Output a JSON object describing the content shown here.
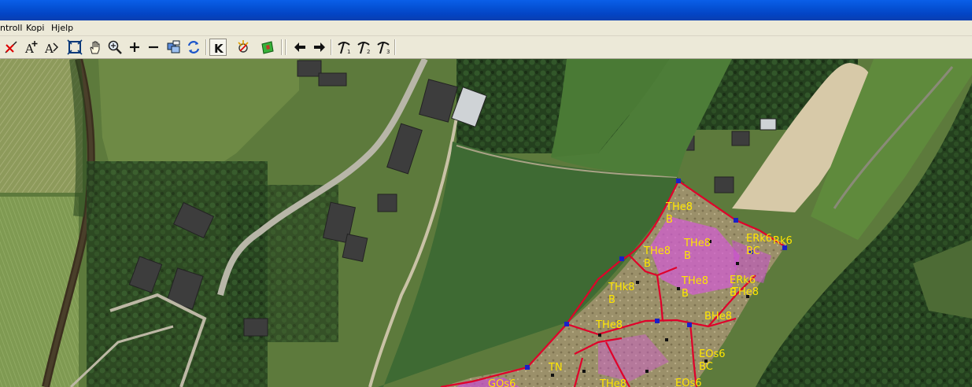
{
  "menu": {
    "items": [
      "ntroll",
      "Kopi",
      "Hjelp"
    ]
  },
  "toolbar": {
    "buttons": [
      "delete-line-icon",
      "text-add-icon",
      "text-edit-icon",
      "zoom-extent-icon",
      "pan-hand-icon",
      "zoom-in-icon",
      "zoom-plus-icon",
      "zoom-minus-icon",
      "layers-icon",
      "refresh-icon",
      "k-mode-icon",
      "select-target-icon",
      "map-layer-icon",
      "arrow-left-icon",
      "arrow-right-icon",
      "pick-1-icon",
      "pick-2-icon",
      "pick-3-icon"
    ]
  },
  "map": {
    "stand_labels": [
      {
        "code": "THe8",
        "sub": "B"
      },
      {
        "code": "THe8",
        "sub": "B"
      },
      {
        "code": "THe8",
        "sub": "B"
      },
      {
        "code": "THe8",
        "sub": "B"
      },
      {
        "code": "THk8",
        "sub": "B"
      },
      {
        "code": "ERk6",
        "sub": "BC"
      },
      {
        "code": "ERk6",
        "sub": "B"
      },
      {
        "code": "THe8",
        "sub": ""
      },
      {
        "code": "EOs6",
        "sub": "BC"
      },
      {
        "code": "THe8",
        "sub": ""
      },
      {
        "code": "BHe8",
        "sub": ""
      },
      {
        "code": "Rk6",
        "sub": ""
      },
      {
        "code": "TN",
        "sub": ""
      },
      {
        "code": "GOs6",
        "sub": ""
      },
      {
        "code": "THe8",
        "sub": ""
      },
      {
        "code": "EOs6",
        "sub": ""
      }
    ]
  },
  "colors": {
    "titlebar": "#0552d6",
    "chrome": "#ece9d8",
    "boundary": "#e0002a",
    "node": "#1a20c8",
    "label": "#ffe600"
  }
}
